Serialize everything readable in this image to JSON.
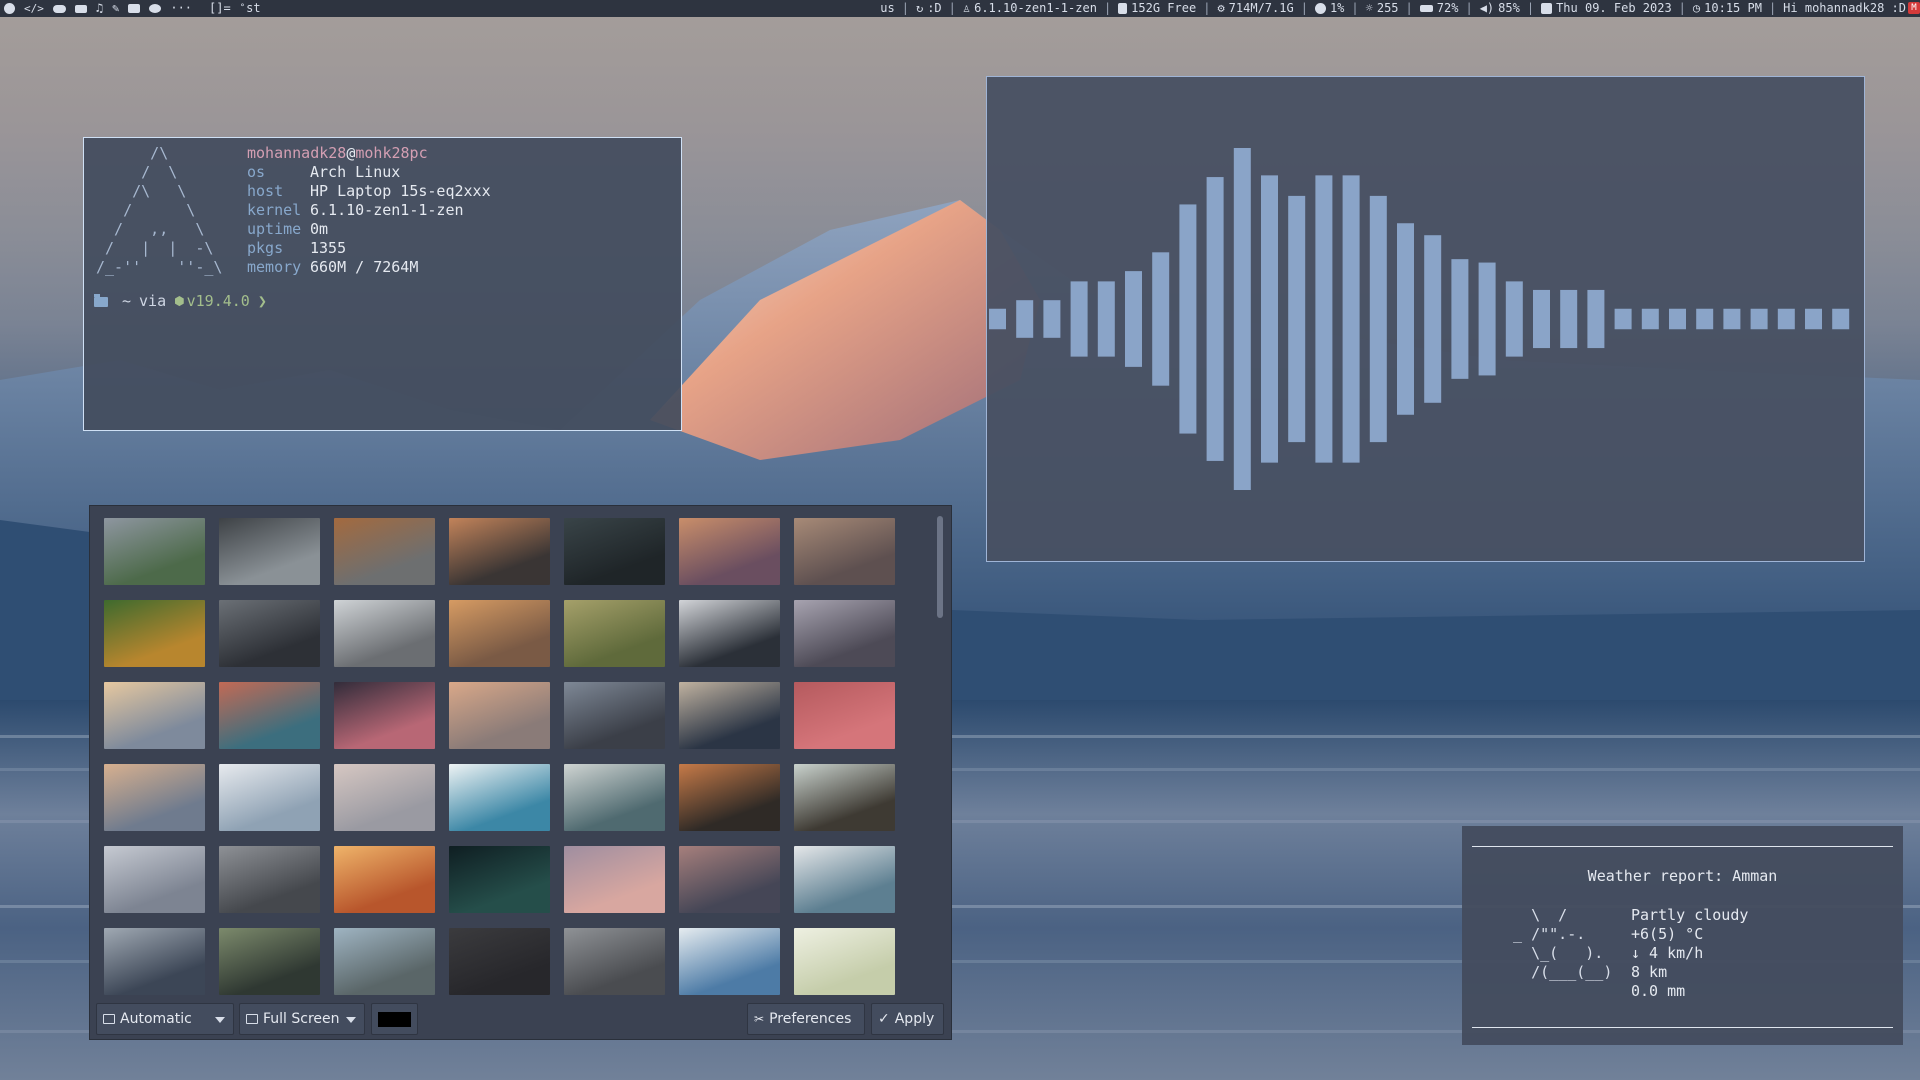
{
  "topbar": {
    "layout_symbol": "[]=",
    "window_title": "st",
    "status": {
      "keyboard": "us",
      "face": ":D",
      "kernel": "6.1.10-zen1-1-zen",
      "disk": "152G Free",
      "memory": "714M/7.1G",
      "cpu": "1%",
      "brightness": "255",
      "battery": "72%",
      "volume": "85%",
      "date": "Thu 09. Feb 2023",
      "time": "10:15 PM",
      "greeting": "Hi mohannadk28 :D"
    },
    "badge": "M"
  },
  "terminal": {
    "ascii": "      /\\\n     /  \\\n    /\\   \\\n   /      \\\n  /   ,,   \\\n /   |  |  -\\\n/_-''    ''-_\\",
    "user": "mohannadk28",
    "at": "@",
    "host_name": "mohk28pc",
    "rows": [
      {
        "key": "os",
        "value": "Arch Linux"
      },
      {
        "key": "host",
        "value": "HP Laptop 15s-eq2xxx"
      },
      {
        "key": "kernel",
        "value": "6.1.10-zen1-1-zen"
      },
      {
        "key": "uptime",
        "value": "0m"
      },
      {
        "key": "pkgs",
        "value": "1355"
      },
      {
        "key": "memory",
        "value": "660M / 7264M"
      }
    ],
    "prompt": {
      "path": "~",
      "via": "via",
      "node_icon": "⬢",
      "node_version": "v19.4.0",
      "symbol": "❯"
    }
  },
  "visualizer": {
    "bar_color": "#8aa4c8",
    "levels": [
      0.06,
      0.11,
      0.11,
      0.22,
      0.22,
      0.28,
      0.39,
      0.67,
      0.83,
      1.0,
      0.84,
      0.72,
      0.84,
      0.84,
      0.72,
      0.56,
      0.49,
      0.35,
      0.33,
      0.22,
      0.17,
      0.17,
      0.17,
      0.06,
      0.06,
      0.06,
      0.06,
      0.06,
      0.06,
      0.06,
      0.06,
      0.06
    ]
  },
  "picker": {
    "thumbs": [
      [
        "#4d6a4a",
        "#8e96a0"
      ],
      [
        "#8a9196",
        "#3e4246"
      ],
      [
        "#6d6f70",
        "#a36a3f"
      ],
      [
        "#3a3534",
        "#c2835a"
      ],
      [
        "#1f2528",
        "#394448"
      ],
      [
        "#6a4e60",
        "#c98e6a"
      ],
      [
        "#5e5050",
        "#a78a77"
      ],
      [
        "#b8862e",
        "#3e6a2e"
      ],
      [
        "#2d3036",
        "#6b7076"
      ],
      [
        "#6b6e72",
        "#cfd3d6"
      ],
      [
        "#7a5a45",
        "#d69b63"
      ],
      [
        "#5f6a3b",
        "#a5a06a"
      ],
      [
        "#2b3038",
        "#d2d4d8"
      ],
      [
        "#4d4a56",
        "#a7a3b0"
      ],
      [
        "#7e8a9c",
        "#e6c8a0"
      ],
      [
        "#3c6e7e",
        "#c26a55"
      ],
      [
        "#b86775",
        "#322c3a"
      ],
      [
        "#8a7b78",
        "#d9a889"
      ],
      [
        "#3b3f48",
        "#7e8896"
      ],
      [
        "#2b3545",
        "#c0b2a0"
      ],
      [
        "#d5757a",
        "#b55a5e"
      ],
      [
        "#6f7b8e",
        "#d7b08f"
      ],
      [
        "#8fa2b4",
        "#e7eaee"
      ],
      [
        "#9a9aa2",
        "#d6c7c2"
      ],
      [
        "#3c87a6",
        "#eef3f4"
      ],
      [
        "#4f6a70",
        "#cfd4d2"
      ],
      [
        "#2f2a26",
        "#c67a48"
      ],
      [
        "#3e3a33",
        "#c9d2cd"
      ],
      [
        "#7d8492",
        "#c6cad2"
      ],
      [
        "#45484d",
        "#8e9196"
      ],
      [
        "#b8562c",
        "#efb46a"
      ],
      [
        "#254e4a",
        "#0f1e22"
      ],
      [
        "#d8a7a0",
        "#9f8ea0"
      ],
      [
        "#454656",
        "#a67f7c"
      ],
      [
        "#5d7f91",
        "#e5e7e9"
      ],
      [
        "#3c4656",
        "#a0a9b3"
      ],
      [
        "#2f3832",
        "#7c8a6c"
      ],
      [
        "#5a6668",
        "#9fb4c2"
      ],
      [
        "#27272b",
        "#3b3b3e"
      ],
      [
        "#4a4c50",
        "#8f9296"
      ],
      [
        "#4d7ba6",
        "#e6ecf0"
      ],
      [
        "#c5cdaa",
        "#eef0e2"
      ]
    ],
    "buttons": {
      "mode": "Automatic",
      "display": "Full Screen",
      "color": "#000000",
      "preferences": "Preferences",
      "apply": "Apply"
    }
  },
  "weather": {
    "title": "Weather report: Amman",
    "art": "   \\  /\n _ /\"\".-.\n   \\_(   ).\n   /(___(__)",
    "lines": [
      "Partly cloudy",
      "+6(5) °C",
      "↓ 4 km/h",
      "8 km",
      "0.0 mm"
    ]
  }
}
